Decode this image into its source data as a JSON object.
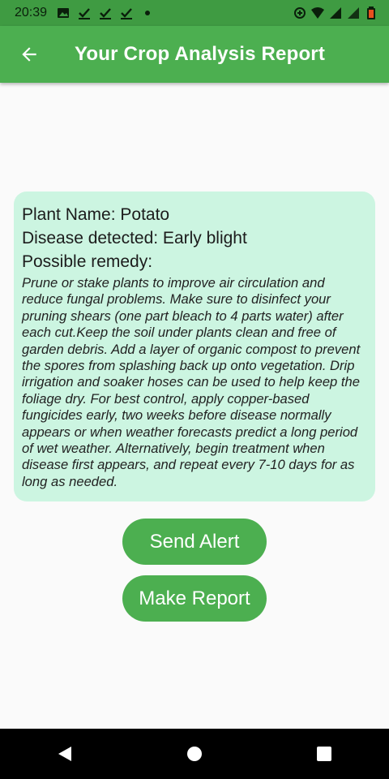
{
  "status_bar": {
    "time": "20:39",
    "icons_left": [
      "image-icon",
      "check-icon",
      "check-icon",
      "check-icon",
      "dot-icon"
    ],
    "icons_right": [
      "data-saver-icon",
      "wifi-icon",
      "signal-icon",
      "signal-icon",
      "battery-icon"
    ]
  },
  "app_bar": {
    "title": "Your Crop Analysis Report",
    "back_icon": "arrow-back-icon"
  },
  "result": {
    "plant_line": "Plant Name: Potato",
    "disease_line": "Disease detected: Early blight",
    "remedy_heading": "Possible remedy:",
    "remedy_text": "Prune or stake plants to improve air circulation and reduce fungal problems. Make sure to disinfect your pruning shears (one part bleach to 4 parts water) after each cut.Keep the soil under plants clean and free of garden debris. Add a layer of organic compost to prevent the spores from splashing back up onto vegetation. Drip irrigation and soaker hoses can be used to help keep the foliage dry. For best control, apply copper-based fungicides early, two weeks before disease normally appears or when weather forecasts predict a long period of wet weather. Alternatively, begin treatment when disease first appears, and repeat every 7-10 days for as long as needed."
  },
  "actions": {
    "send_alert": "Send Alert",
    "make_report": "Make Report"
  },
  "nav_bar": {
    "icons": [
      "back-triangle-icon",
      "home-circle-icon",
      "recents-square-icon"
    ]
  },
  "colors": {
    "primary": "#4caf50",
    "status_bar": "#3f9b42",
    "card": "#ccf5e1",
    "background": "#fafafa",
    "battery": "#e8501f"
  }
}
